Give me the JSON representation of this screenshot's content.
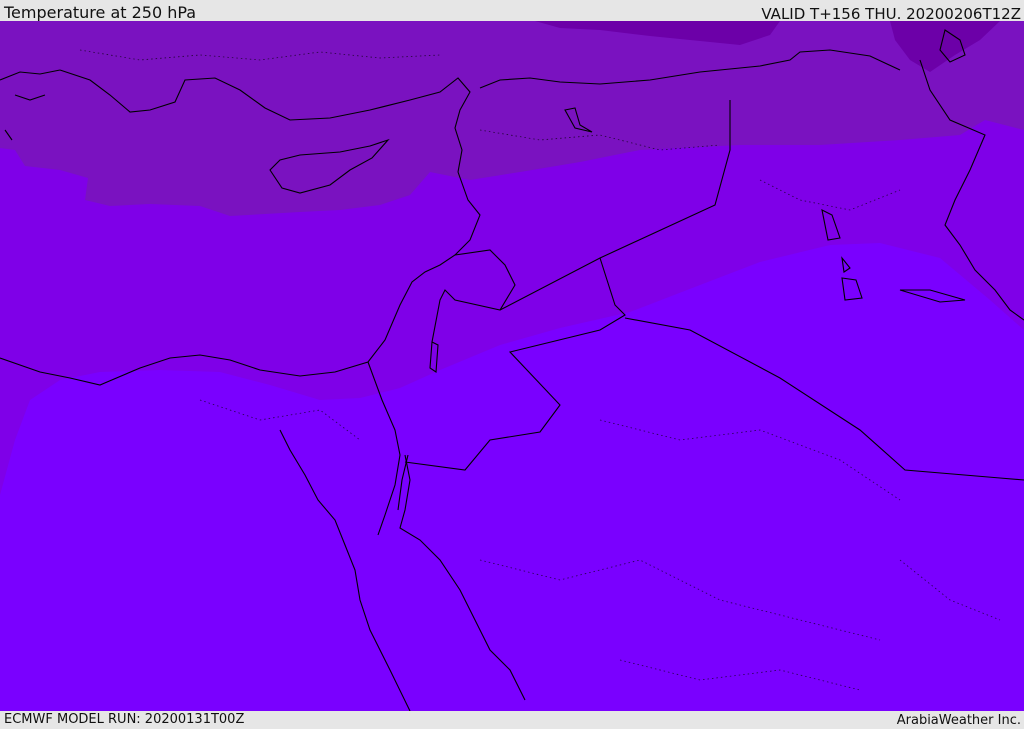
{
  "header": {
    "title": "Temperature at 250 hPa",
    "valid_time": "VALID T+156 THU. 20200206T12Z"
  },
  "footer": {
    "model_run": "ECMWF MODEL RUN: 20200131T00Z",
    "credit": "ArabiaWeather Inc."
  },
  "map": {
    "colors": {
      "warmest_band": "#7a00ff",
      "mid_band": "#7f00e8",
      "cold_band": "#7a12c0",
      "coldest_band": "#6c00a8",
      "coastline": "#000000"
    }
  }
}
